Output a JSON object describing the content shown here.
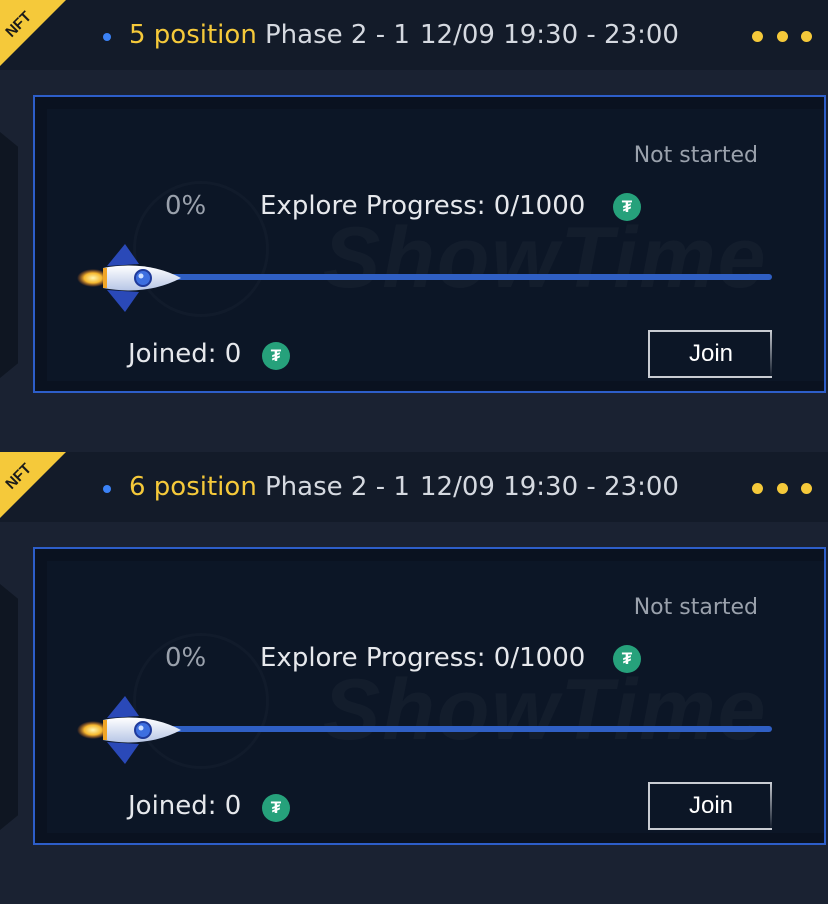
{
  "cards": [
    {
      "badge": "NFT",
      "position": "5 position",
      "phase": "Phase 2 - 1",
      "time": "12/09 19:30 - 23:00",
      "status": "Not started",
      "percent": "0%",
      "progress": "Explore Progress: 0/1000",
      "progress_fraction": 0,
      "joined": "Joined: 0",
      "join_label": "Join",
      "watermark": "ShowTime",
      "coin_symbol": "₮"
    },
    {
      "badge": "NFT",
      "position": "6 position",
      "phase": "Phase 2 - 1",
      "time": "12/09 19:30 - 23:00",
      "status": "Not started",
      "percent": "0%",
      "progress": "Explore Progress: 0/1000",
      "progress_fraction": 0,
      "joined": "Joined: 0",
      "join_label": "Join",
      "watermark": "ShowTime",
      "coin_symbol": "₮"
    }
  ],
  "colors": {
    "accent": "#f5c93a",
    "progress_track": "#2f5fc4",
    "panel_border": "#2d5ec9",
    "coin": "#26a17b"
  }
}
